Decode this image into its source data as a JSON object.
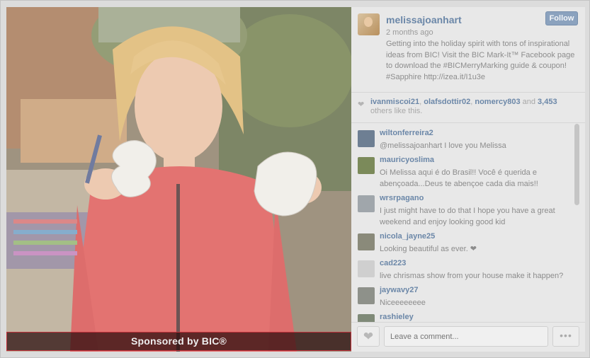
{
  "post": {
    "sponsored_label": "Sponsored by BIC®"
  },
  "author": {
    "username": "melissajoanhart",
    "time": "2 months ago",
    "follow_label": "Follow",
    "caption": "Getting into the holiday spirit with tons of inspirational ideas from BIC! Visit the BIC Mark-It™ Facebook page to download the #BICMerryMarking guide & coupon! #Sapphire http://izea.it/I1u3e"
  },
  "likes": {
    "users": [
      "ivanmiscoi21",
      "olafsdottir02",
      "nomercy803"
    ],
    "sep1": ", ",
    "sep2": ", ",
    "and_word": " and ",
    "count": "3,453",
    "suffix": " others like this."
  },
  "comments": [
    {
      "user": "wiltonferreira2",
      "text": "@melissajoanhart I love you Melissa",
      "avatar_color": "#6e7f93"
    },
    {
      "user": "mauricyoslima",
      "text": "Oi Melissa aqui é do Brasil!! Você é querida e abençoada...Deus te abençoe cada dia mais!!",
      "avatar_color": "#7b8a5a"
    },
    {
      "user": "wrsrpagano",
      "text": "I just might have to do that I hope you have a great weekend and enjoy looking good kid",
      "avatar_color": "#a0a6ab"
    },
    {
      "user": "nicola_jayne25",
      "text": "Looking beautiful as ever. ❤",
      "avatar_color": "#8a8a7a"
    },
    {
      "user": "cad223",
      "text": "live chrismas show from your house make it happen?",
      "avatar_color": "#cfcfcf"
    },
    {
      "user": "jaywavy27",
      "text": "Niceeeeeeee",
      "avatar_color": "#8e918a"
    },
    {
      "user": "rashieley",
      "text": "",
      "avatar_color": "#7f8a78"
    }
  ],
  "footer": {
    "comment_placeholder": "Leave a comment...",
    "more_label": "•••"
  },
  "icons": {
    "like": "heart-icon",
    "more": "ellipsis-icon"
  }
}
